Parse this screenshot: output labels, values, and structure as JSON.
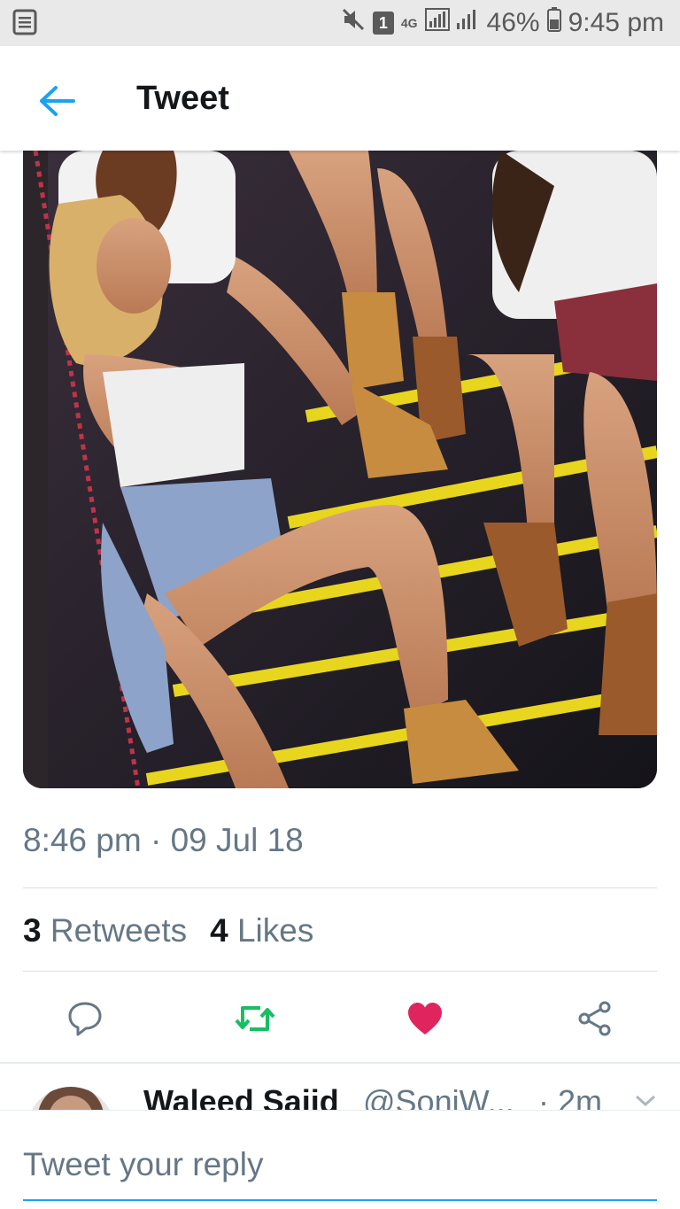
{
  "status_bar": {
    "signal_label": "1",
    "network_label": "4G",
    "battery": "46%",
    "time": "9:45 pm"
  },
  "header": {
    "title": "Tweet"
  },
  "tweet": {
    "timestamp": "8:46 pm · 09 Jul 18",
    "retweets_count": "3",
    "retweets_label": "Retweets",
    "likes_count": "4",
    "likes_label": "Likes"
  },
  "colors": {
    "accent": "#1da1f2",
    "retweet": "#17bf63",
    "like": "#e0245e",
    "muted": "#657786"
  },
  "icons": {
    "reply": "reply-icon",
    "retweet": "retweet-icon",
    "like": "heart-icon",
    "share": "share-icon"
  },
  "reply_preview": {
    "name": "Waleed Sajid",
    "handle": "@SoniW...",
    "time": "· 2m"
  },
  "composer": {
    "placeholder": "Tweet your reply"
  }
}
